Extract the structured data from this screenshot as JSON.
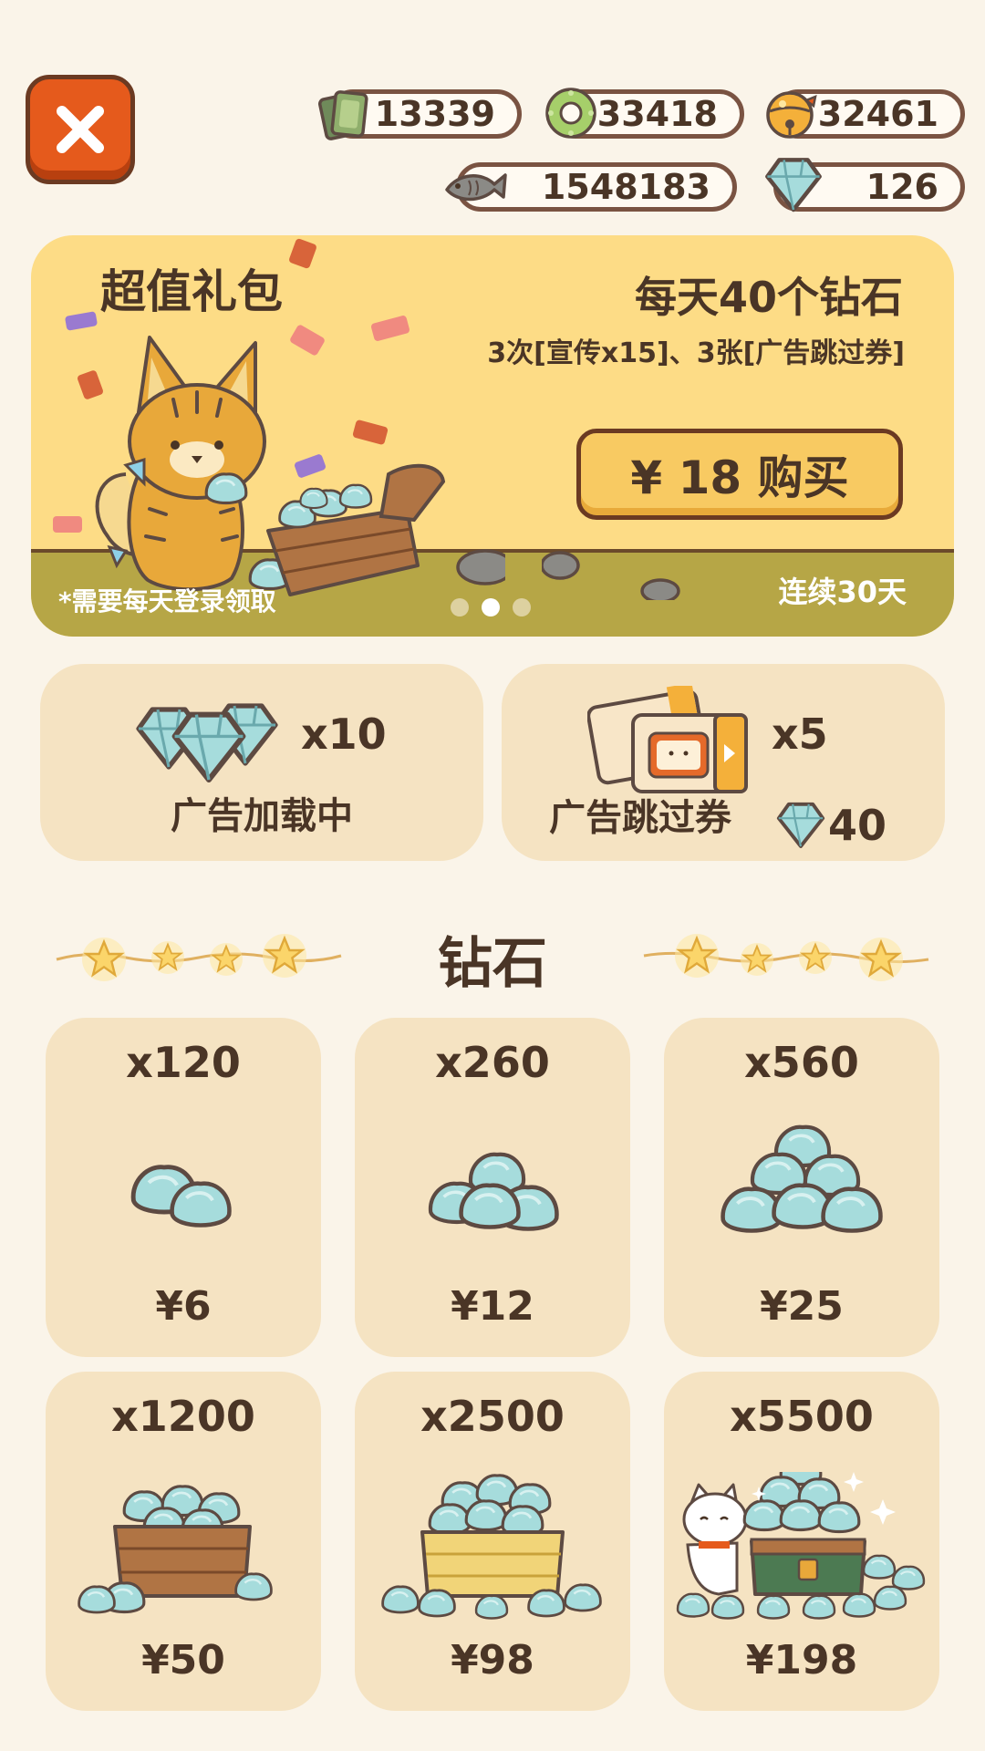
{
  "currencies": {
    "cash": "13339",
    "coins": "33418",
    "bells": "32461",
    "fish": "1548183",
    "diamonds": "126"
  },
  "banner": {
    "title": "超值礼包",
    "headline": "每天40个钻石",
    "subline": "3次[宣传x15]、3张[广告跳过券]",
    "buy_label": "¥ 18 购买",
    "note": "*需要每天登录领取",
    "duration": "连续30天",
    "page_dots": 3,
    "active_dot": 2
  },
  "ad_reward": {
    "count": "x10",
    "label": "广告加载中"
  },
  "skip_ticket": {
    "count": "x5",
    "label": "广告跳过券",
    "price": "40"
  },
  "section_title": "钻石",
  "packs": [
    {
      "qty": "x120",
      "price": "¥6"
    },
    {
      "qty": "x260",
      "price": "¥12"
    },
    {
      "qty": "x560",
      "price": "¥25"
    },
    {
      "qty": "x1200",
      "price": "¥50"
    },
    {
      "qty": "x2500",
      "price": "¥98"
    },
    {
      "qty": "x5500",
      "price": "¥198"
    }
  ],
  "icons": {
    "close": "close-icon",
    "cash": "cash-stack-icon",
    "coins": "coin-ring-icon",
    "bells": "golden-bell-icon",
    "fish": "fish-icon",
    "diamonds": "diamond-icon"
  },
  "colors": {
    "background": "#faf4e9",
    "card": "#f5e3c2",
    "banner": "#fddc86",
    "accent_orange": "#e55a1c",
    "text": "#4a3526",
    "diamond": "#9fd6d8"
  }
}
